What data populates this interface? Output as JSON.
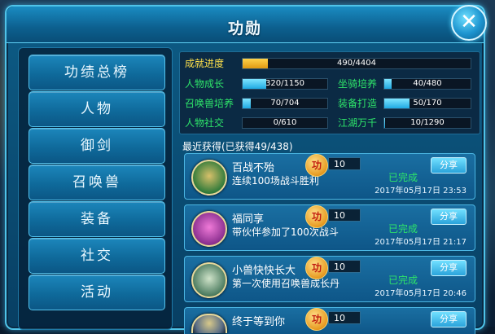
{
  "window": {
    "title": "功勋",
    "close_label": "✕"
  },
  "nav": {
    "items": [
      "功绩总榜",
      "人物",
      "御剑",
      "召唤兽",
      "装备",
      "社交",
      "活动"
    ]
  },
  "stats": {
    "progress": {
      "label": "成就进度",
      "value": 490,
      "max": 4404,
      "text": "490/4404",
      "color": "#ffd34a"
    },
    "rows": [
      {
        "label": "人物成长",
        "text": "320/1150",
        "value": 320,
        "max": 1150
      },
      {
        "label": "坐骑培养",
        "text": "40/480",
        "value": 40,
        "max": 480
      },
      {
        "label": "召唤兽培养",
        "text": "70/704",
        "value": 70,
        "max": 704
      },
      {
        "label": "装备打造",
        "text": "50/170",
        "value": 50,
        "max": 170
      },
      {
        "label": "人物社交",
        "text": "0/610",
        "value": 0,
        "max": 610
      },
      {
        "label": "江湖万千",
        "text": "10/1290",
        "value": 10,
        "max": 1290
      }
    ]
  },
  "recent": {
    "label": "最近获得(已获得49/438)",
    "items": [
      {
        "name": "百战不殆",
        "desc": "连续100场战斗胜利",
        "points": "10",
        "status": "已完成",
        "share": "分享",
        "date": "2017年05月17日  23:53",
        "avatar_colors": [
          "#d7c06a",
          "#2f7a3a"
        ]
      },
      {
        "name": "福同享",
        "desc": "带伙伴参加了100次战斗",
        "points": "10",
        "status": "已完成",
        "share": "分享",
        "date": "2017年05月17日  21:17",
        "avatar_colors": [
          "#f07ad8",
          "#8a2f8f"
        ]
      },
      {
        "name": "小兽快快长大",
        "desc": "第一次使用召唤兽成长丹",
        "points": "10",
        "status": "已完成",
        "share": "分享",
        "date": "2017年05月17日  20:46",
        "avatar_colors": [
          "#cfe3c9",
          "#4b7b5f"
        ]
      },
      {
        "name": "终于等到你",
        "desc": "",
        "points": "10",
        "status": "",
        "share": "分享",
        "date": "",
        "avatar_colors": [
          "#d8c98a",
          "#5a6d86"
        ]
      }
    ],
    "medal_char": "功"
  },
  "colors": {
    "accent": "#4fc3e8",
    "green": "#2ee56a",
    "gold": "#ffe14a"
  }
}
